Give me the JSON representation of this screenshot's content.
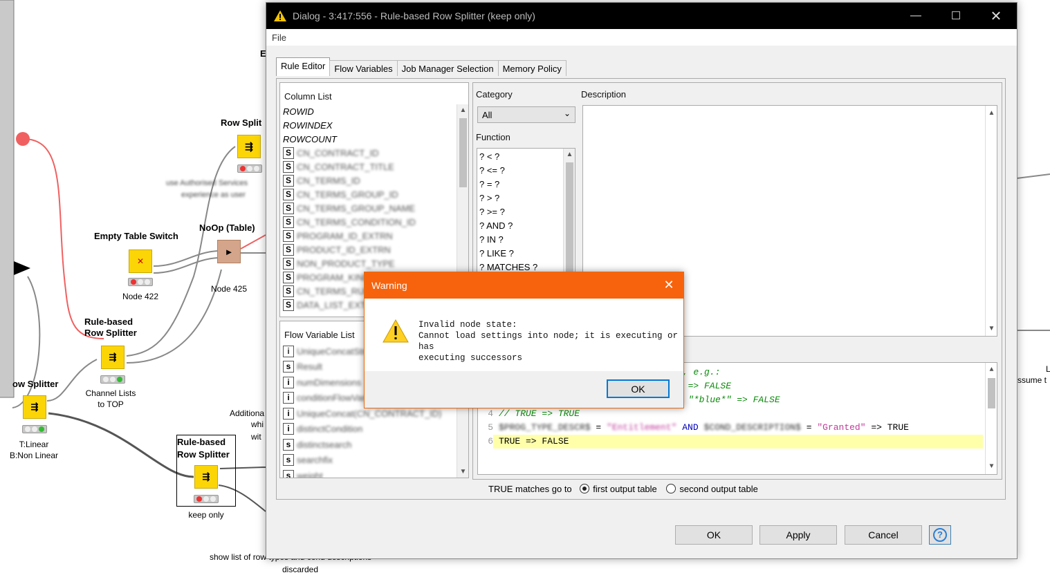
{
  "workflow": {
    "nodes": [
      {
        "label": "Row Split",
        "sub": ""
      },
      {
        "label": "Empty Table Switch",
        "sub": "Node 422"
      },
      {
        "label": "NoOp (Table)",
        "sub": "Node 425"
      },
      {
        "label": "Rule-based\nRow Splitter",
        "sub": "Channel Lists\nto TOP"
      },
      {
        "label": "ow Splitter",
        "sub": "T:Linear\nB:Non Linear"
      },
      {
        "label": "Rule-based\nRow Splitter",
        "sub": "keep only"
      }
    ],
    "annotations": {
      "additional": "Additiona",
      "wh": "whi",
      "with": "wit",
      "b_fragment": "E",
      "show_list": "show list of row types and cond descriptions",
      "discarded": "discarded",
      "right_l": "L",
      "assume": "ssume t"
    }
  },
  "dialog": {
    "title": "Dialog - 3:417:556 - Rule-based Row Splitter (keep only)",
    "menu": {
      "file": "File"
    },
    "tabs": [
      "Rule Editor",
      "Flow Variables",
      "Job Manager Selection",
      "Memory Policy"
    ],
    "column_list": {
      "label": "Column List",
      "special": [
        "ROWID",
        "ROWINDEX",
        "ROWCOUNT"
      ],
      "columns": [
        "CN_CONTRACT_ID",
        "CN_CONTRACT_TITLE",
        "CN_TERMS_ID",
        "CN_TERMS_GROUP_ID",
        "CN_TERMS_GROUP_NAME",
        "CN_TERMS_CONDITION_ID",
        "PROGRAM_ID_EXTRN",
        "PRODUCT_ID_EXTRN",
        "NON_PRODUCT_TYPE",
        "PROGRAM_KIND_CODE_DESCR",
        "CN_TERMS_RULE",
        "DATA_LIST_EXTN"
      ]
    },
    "flow_variable_list": {
      "label": "Flow Variable List",
      "vars": [
        {
          "type": "i",
          "name": "UniqueConcatString(CN"
        },
        {
          "type": "s",
          "name": "Result"
        },
        {
          "type": "i",
          "name": "numDimensions"
        },
        {
          "type": "i",
          "name": "conditionFlowVariation"
        },
        {
          "type": "i",
          "name": "UniqueConcat(CN_CONTRACT_ID)"
        },
        {
          "type": "i",
          "name": "distinctCondition"
        },
        {
          "type": "s",
          "name": "distinctsearch"
        },
        {
          "type": "s",
          "name": "searchfix"
        },
        {
          "type": "s",
          "name": "weight"
        }
      ]
    },
    "category": {
      "label": "Category",
      "selected": "All"
    },
    "function": {
      "label": "Function",
      "items": [
        "? < ?",
        "? <= ?",
        "? = ?",
        "? > ?",
        "? >= ?",
        "? AND ?",
        "? IN ?",
        "? LIKE ?",
        "? MATCHES ?"
      ]
    },
    "description": {
      "label": "Description"
    },
    "code": {
      "l1_tail": "s, e.g.:",
      "l2_tail": "0 => FALSE",
      "l3_tail": "\"*blue*\" => FALSE",
      "l4": "// TRUE => TRUE",
      "l5_a": "$PROG_TYPE_DESCR$",
      "l5_b": " = ",
      "l5_c": "\"Entitlement\"",
      "l5_d": " AND ",
      "l5_e": "$COND_DESCRIPTION$",
      "l5_f": " = ",
      "l5_g": "\"Granted\"",
      "l5_h": " => TRUE",
      "l6": "TRUE => FALSE",
      "line_numbers": [
        "4",
        "5",
        "6"
      ]
    },
    "true_matches_label": "TRUE matches go to",
    "radio_first": "first output table",
    "radio_second": "second output table",
    "buttons": {
      "ok": "OK",
      "apply": "Apply",
      "cancel": "Cancel",
      "help": "?"
    }
  },
  "warning": {
    "title": "Warning",
    "message_line1": "Invalid node state:",
    "message_line2": "Cannot load settings into node; it is executing or has",
    "message_line3": "executing successors",
    "ok": "OK"
  },
  "colors": {
    "accent_warning": "#f7630c",
    "node_yellow": "#fbd506",
    "titlebar": "#000000"
  }
}
